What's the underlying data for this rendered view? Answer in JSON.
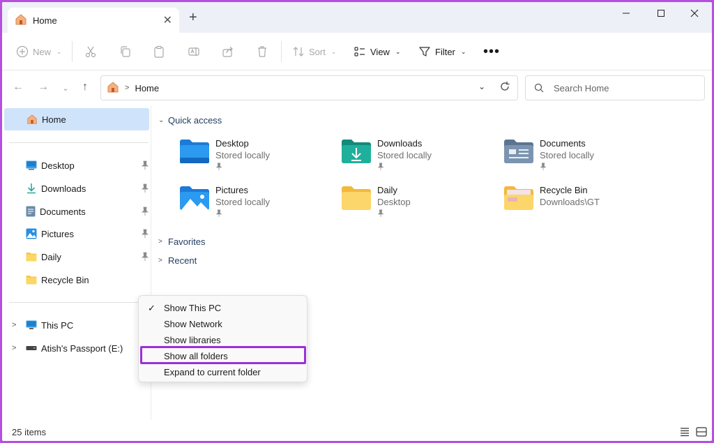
{
  "tab": {
    "title": "Home"
  },
  "toolbar": {
    "new_label": "New",
    "sort_label": "Sort",
    "view_label": "View",
    "filter_label": "Filter"
  },
  "address": {
    "crumb": "Home"
  },
  "search": {
    "placeholder": "Search Home"
  },
  "sidebar": {
    "home_label": "Home",
    "pinned": [
      {
        "label": "Desktop",
        "icon": "desktop-icon"
      },
      {
        "label": "Downloads",
        "icon": "downloads-icon"
      },
      {
        "label": "Documents",
        "icon": "documents-icon"
      },
      {
        "label": "Pictures",
        "icon": "pictures-icon"
      },
      {
        "label": "Daily",
        "icon": "folder-icon"
      },
      {
        "label": "Recycle Bin",
        "icon": "folder-icon"
      }
    ],
    "this_pc": "This PC",
    "drive": "Atish's Passport  (E:)"
  },
  "main": {
    "quick_access": "Quick access",
    "favorites": "Favorites",
    "recent": "Recent",
    "items": [
      {
        "name": "Desktop",
        "sub": "Stored locally"
      },
      {
        "name": "Downloads",
        "sub": "Stored locally"
      },
      {
        "name": "Documents",
        "sub": "Stored locally"
      },
      {
        "name": "Pictures",
        "sub": "Stored locally"
      },
      {
        "name": "Daily",
        "sub": "Desktop"
      },
      {
        "name": "Recycle Bin",
        "sub": "Downloads\\GT"
      }
    ]
  },
  "context_menu": {
    "items": [
      "Show This PC",
      "Show Network",
      "Show libraries",
      "Show all folders",
      "Expand to current folder"
    ],
    "checked_index": 0,
    "highlighted_index": 3
  },
  "status": {
    "items": "25 items"
  },
  "colors": {
    "accent": "#b64fe0",
    "highlight_border": "#9b30d9",
    "selected_bg": "#cfe4fa"
  }
}
